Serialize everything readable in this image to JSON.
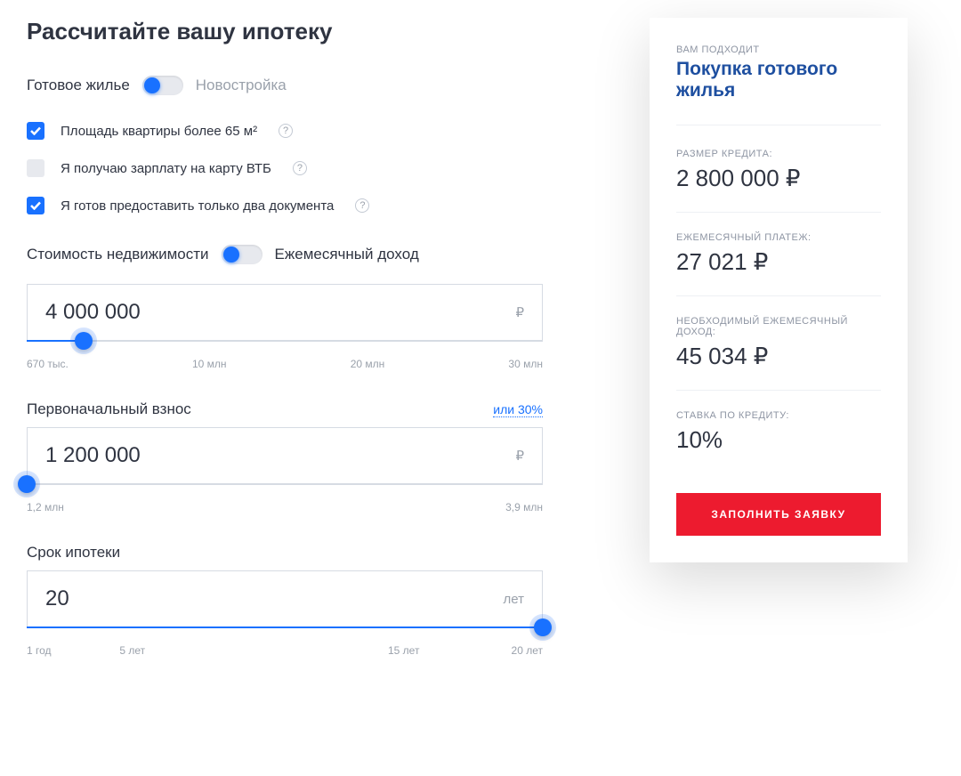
{
  "heading": "Рассчитайте вашу ипотеку",
  "housingToggle": {
    "left": "Готовое жилье",
    "right": "Новостройка"
  },
  "checks": {
    "area": "Площадь квартиры более 65 м²",
    "salary": "Я получаю зарплату на карту ВТБ",
    "twoDocs": "Я готов предоставить только два документа"
  },
  "basisToggle": {
    "left": "Стоимость недвижимости",
    "right": "Ежемесячный доход"
  },
  "price": {
    "value": "4 000 000",
    "unit": "₽",
    "ticks": [
      "670 тыс.",
      "10 млн",
      "20 млн",
      "30 млн"
    ]
  },
  "down": {
    "label": "Первоначальный взнос",
    "percent": "или 30%",
    "value": "1 200 000",
    "unit": "₽",
    "ticks": [
      "1,2 млн",
      "3,9 млн"
    ]
  },
  "term": {
    "label": "Срок ипотеки",
    "value": "20",
    "unit": "лет",
    "ticks": [
      "1 год",
      "5 лет",
      "15 лет",
      "20 лет"
    ]
  },
  "summary": {
    "fitLabel": "ВАМ ПОДХОДИТ",
    "fitValue": "Покупка готового жилья",
    "loanLabel": "РАЗМЕР КРЕДИТА:",
    "loanValue": "2 800 000 ₽",
    "monthlyLabel": "ЕЖЕМЕСЯЧНЫЙ ПЛАТЕЖ:",
    "monthlyValue": "27 021 ₽",
    "incomeLabel": "НЕОБХОДИМЫЙ ЕЖЕМЕСЯЧНЫЙ ДОХОД:",
    "incomeValue": "45 034 ₽",
    "rateLabel": "СТАВКА ПО КРЕДИТУ:",
    "rateValue": "10%",
    "cta": "ЗАПОЛНИТЬ ЗАЯВКУ"
  }
}
